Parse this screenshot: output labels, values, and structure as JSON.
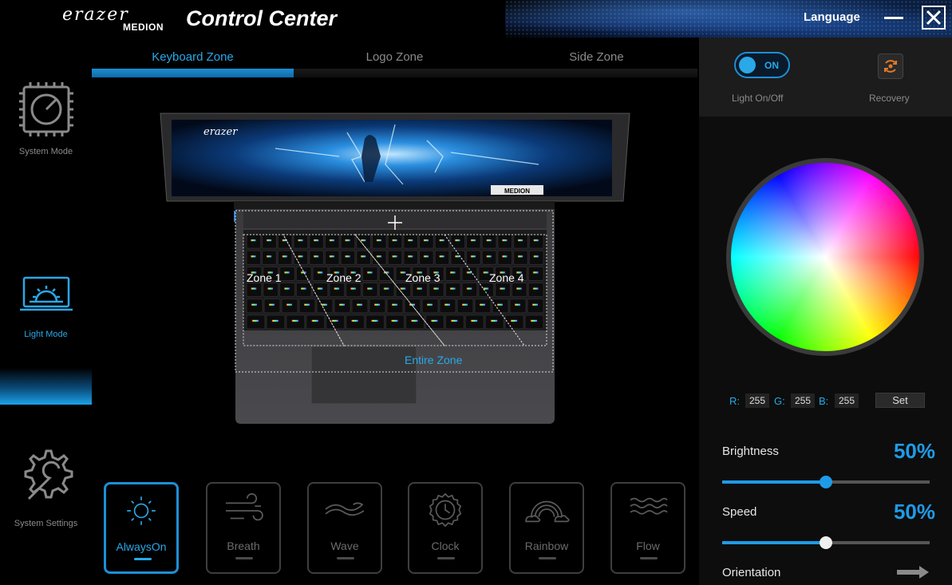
{
  "app": {
    "brand_name": "erazer",
    "brand_maker": "MEDION",
    "title": "Control Center",
    "language_label": "Language"
  },
  "sidebar": {
    "items": [
      {
        "label": "System Mode",
        "active": false
      },
      {
        "label": "Light Mode",
        "active": true
      },
      {
        "label": "System Settings",
        "active": false
      }
    ]
  },
  "tabs": [
    {
      "label": "Keyboard Zone",
      "active": true
    },
    {
      "label": "Logo Zone",
      "active": false
    },
    {
      "label": "Side Zone",
      "active": false
    }
  ],
  "laptop": {
    "screen_brand": "erazer",
    "screen_badge": "MEDION",
    "zones": [
      "Zone 1",
      "Zone 2",
      "Zone 3",
      "Zone 4"
    ],
    "entire_zone_label": "Entire Zone"
  },
  "effects": [
    {
      "label": "AlwaysOn",
      "icon": "sun-icon",
      "active": true
    },
    {
      "label": "Breath",
      "icon": "wind-icon",
      "active": false
    },
    {
      "label": "Wave",
      "icon": "wave-icon",
      "active": false
    },
    {
      "label": "Clock",
      "icon": "clock-icon",
      "active": false
    },
    {
      "label": "Rainbow",
      "icon": "rainbow-icon",
      "active": false
    },
    {
      "label": "Flow",
      "icon": "flow-icon",
      "active": false
    }
  ],
  "panel": {
    "toggle_state": "ON",
    "light_onoff_label": "Light On/Off",
    "recovery_label": "Recovery",
    "rgb": {
      "r_label": "R:",
      "r": "255",
      "g_label": "G:",
      "g": "255",
      "b_label": "B:",
      "b": "255"
    },
    "set_label": "Set",
    "brightness": {
      "label": "Brightness",
      "value_text": "50%",
      "value": 50
    },
    "speed": {
      "label": "Speed",
      "value_text": "50%",
      "value": 50
    },
    "orientation_label": "Orientation"
  },
  "colors": {
    "accent": "#1f9be6",
    "background": "#000000",
    "panel": "#0d0d0d"
  }
}
